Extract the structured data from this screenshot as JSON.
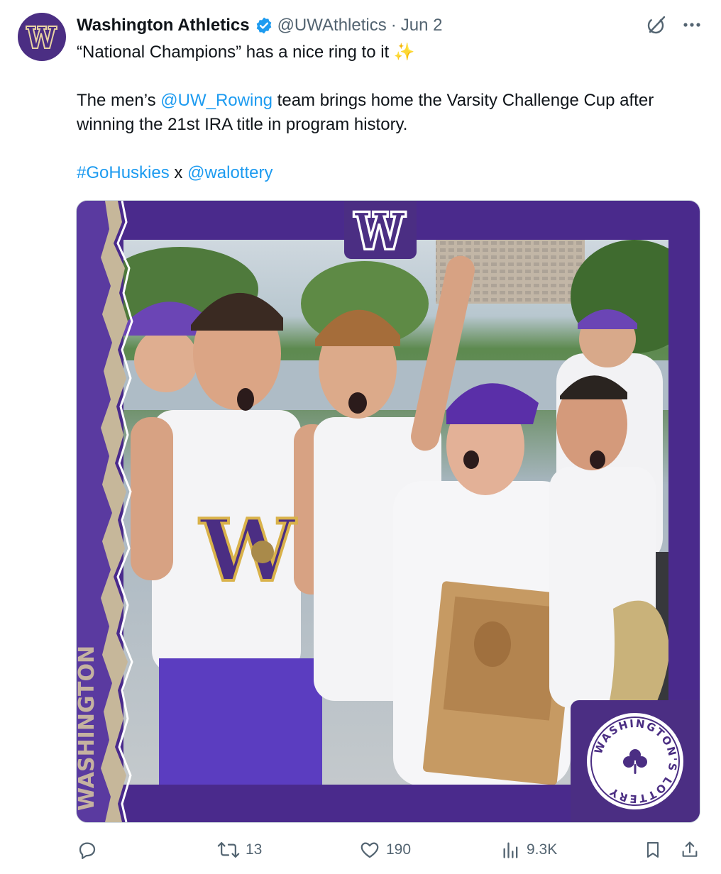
{
  "author": {
    "name": "Washington Athletics",
    "handle": "@UWAthletics",
    "separator": "·",
    "date": "Jun 2",
    "avatar_icon": "uw-w-logo",
    "verified_icon": "verified-badge-icon"
  },
  "tweet": {
    "line1": "“National Champions” has a nice ring to it ✨",
    "para2_pre": "The men’s ",
    "para2_mention": "@UW_Rowing",
    "para2_post": " team brings home the Varsity Challenge Cup after winning the 21st IRA title in program history.",
    "hashtag": "#GoHuskies",
    "joiner": " x ",
    "mention2": "@walottery"
  },
  "media": {
    "brand_mark": "W",
    "lottery_badge": "WASHINGTON'S LOTTERY",
    "side_text": "WASHINGTON"
  },
  "actions": {
    "reply_count": "",
    "retweet_count": "13",
    "like_count": "190",
    "views_count": "9.3K"
  },
  "colors": {
    "link": "#1d9bf0",
    "uw_purple": "#4b2e83",
    "uw_gold": "#b7a57a",
    "muted": "#536471"
  }
}
